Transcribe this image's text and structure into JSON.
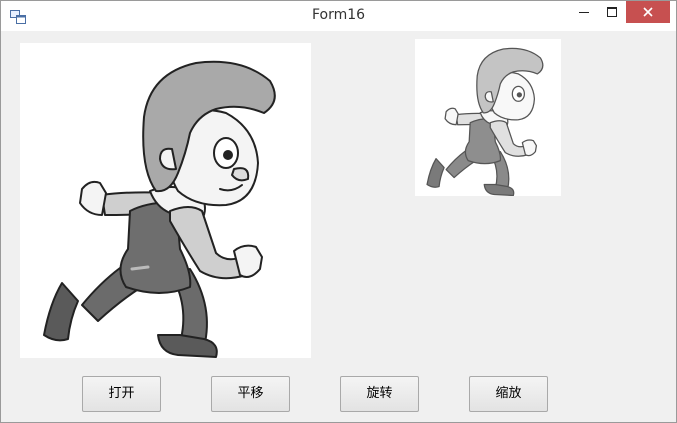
{
  "window": {
    "title": "Form16"
  },
  "buttons": {
    "open": "打开",
    "translate": "平移",
    "rotate": "旋转",
    "scale": "缩放"
  },
  "images": {
    "main": "cartoon-boy-running",
    "small": "cartoon-boy-running-scaled"
  },
  "colors": {
    "close_button": "#c75050",
    "form_background": "#f0f0f0"
  }
}
